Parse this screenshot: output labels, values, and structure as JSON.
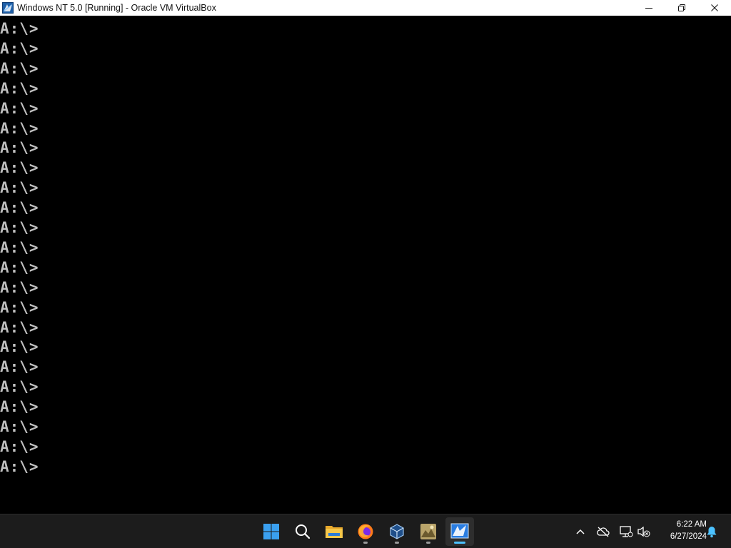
{
  "window": {
    "title": "Windows NT 5.0 [Running] - Oracle VM VirtualBox",
    "controls": {
      "minimize": "—",
      "restore": "❐",
      "close": "✕"
    }
  },
  "console": {
    "lines": [
      "A:\\>",
      "A:\\>",
      "A:\\>",
      "A:\\>",
      "A:\\>",
      "A:\\>",
      "A:\\>",
      "A:\\>",
      "A:\\>",
      "A:\\>",
      "A:\\>",
      "A:\\>",
      "A:\\>",
      "A:\\>",
      "A:\\>",
      "A:\\>",
      "A:\\>",
      "A:\\>",
      "A:\\>",
      "A:\\>",
      "A:\\>",
      "A:\\>",
      "A:\\>"
    ],
    "text_color": "#c0c0c0",
    "background": "#000000"
  },
  "taskbar": {
    "apps": [
      {
        "name": "start-button",
        "icon": "windows-logo-icon"
      },
      {
        "name": "search-button",
        "icon": "search-icon"
      },
      {
        "name": "file-explorer",
        "icon": "folder-icon"
      },
      {
        "name": "firefox",
        "icon": "firefox-icon"
      },
      {
        "name": "virtualbox-manager",
        "icon": "virtualbox-icon"
      },
      {
        "name": "image-app",
        "icon": "picture-icon"
      },
      {
        "name": "virtualbox-vm-window",
        "icon": "vm-window-icon"
      }
    ],
    "tray": {
      "clock_time": "6:22 AM",
      "clock_date": "6/27/2024"
    },
    "accent": "#4cc2ff"
  }
}
